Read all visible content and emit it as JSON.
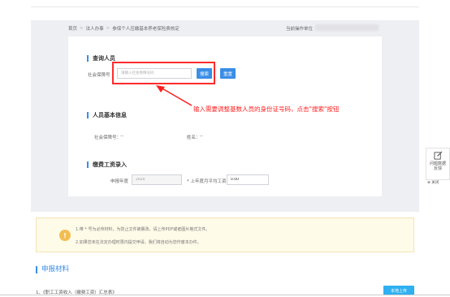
{
  "breadcrumb": {
    "home": "首页",
    "legal": "法人办事",
    "current": "参保个人应缴基本养老保险费核定",
    "separator": ">"
  },
  "operator": {
    "label": "当前操作单位"
  },
  "query_section": {
    "title": "查询人员",
    "field_label": "社会保障号",
    "input_value": "",
    "input_placeholder": "请输入社会保障号码",
    "search_button": "搜索",
    "reset_button": "重置"
  },
  "annotation": {
    "text": "输入需要调整基数人员的身份证号码，点击\"搜索\"按钮"
  },
  "basic_info": {
    "title": "人员基本信息",
    "ssn_label": "社会保障号：",
    "ssn_value": "--",
    "name_label": "姓名：",
    "name_value": "--"
  },
  "wage_section": {
    "title": "缴费工资录入",
    "year_label": "申报年度",
    "year_value": "2020",
    "avg_wage_label": "* 上年度月平均工资",
    "avg_wage_value": "0.00"
  },
  "side_widget": {
    "text": "问题数据反馈",
    "close_label": "⊗ 关闭"
  },
  "notice": {
    "icon": "!",
    "line1": "1.带 * 号为必传材料，为防止文件被篡改，请上传PDF或者图片格式文件。",
    "line2": "2.如果您未在法定办理时限内提交申请，我们将自动为您作废本办件。"
  },
  "materials": {
    "title": "申报材料",
    "item1": "1、《职工工资收入（缴费工资）汇总表》",
    "upload_button": "本地上传"
  },
  "colors": {
    "accent": "#3a8ee6",
    "highlight": "#ff2b2b",
    "notice_bg": "#fffbe9",
    "notice_icon": "#f2be52",
    "upload": "#2fb0f0"
  }
}
